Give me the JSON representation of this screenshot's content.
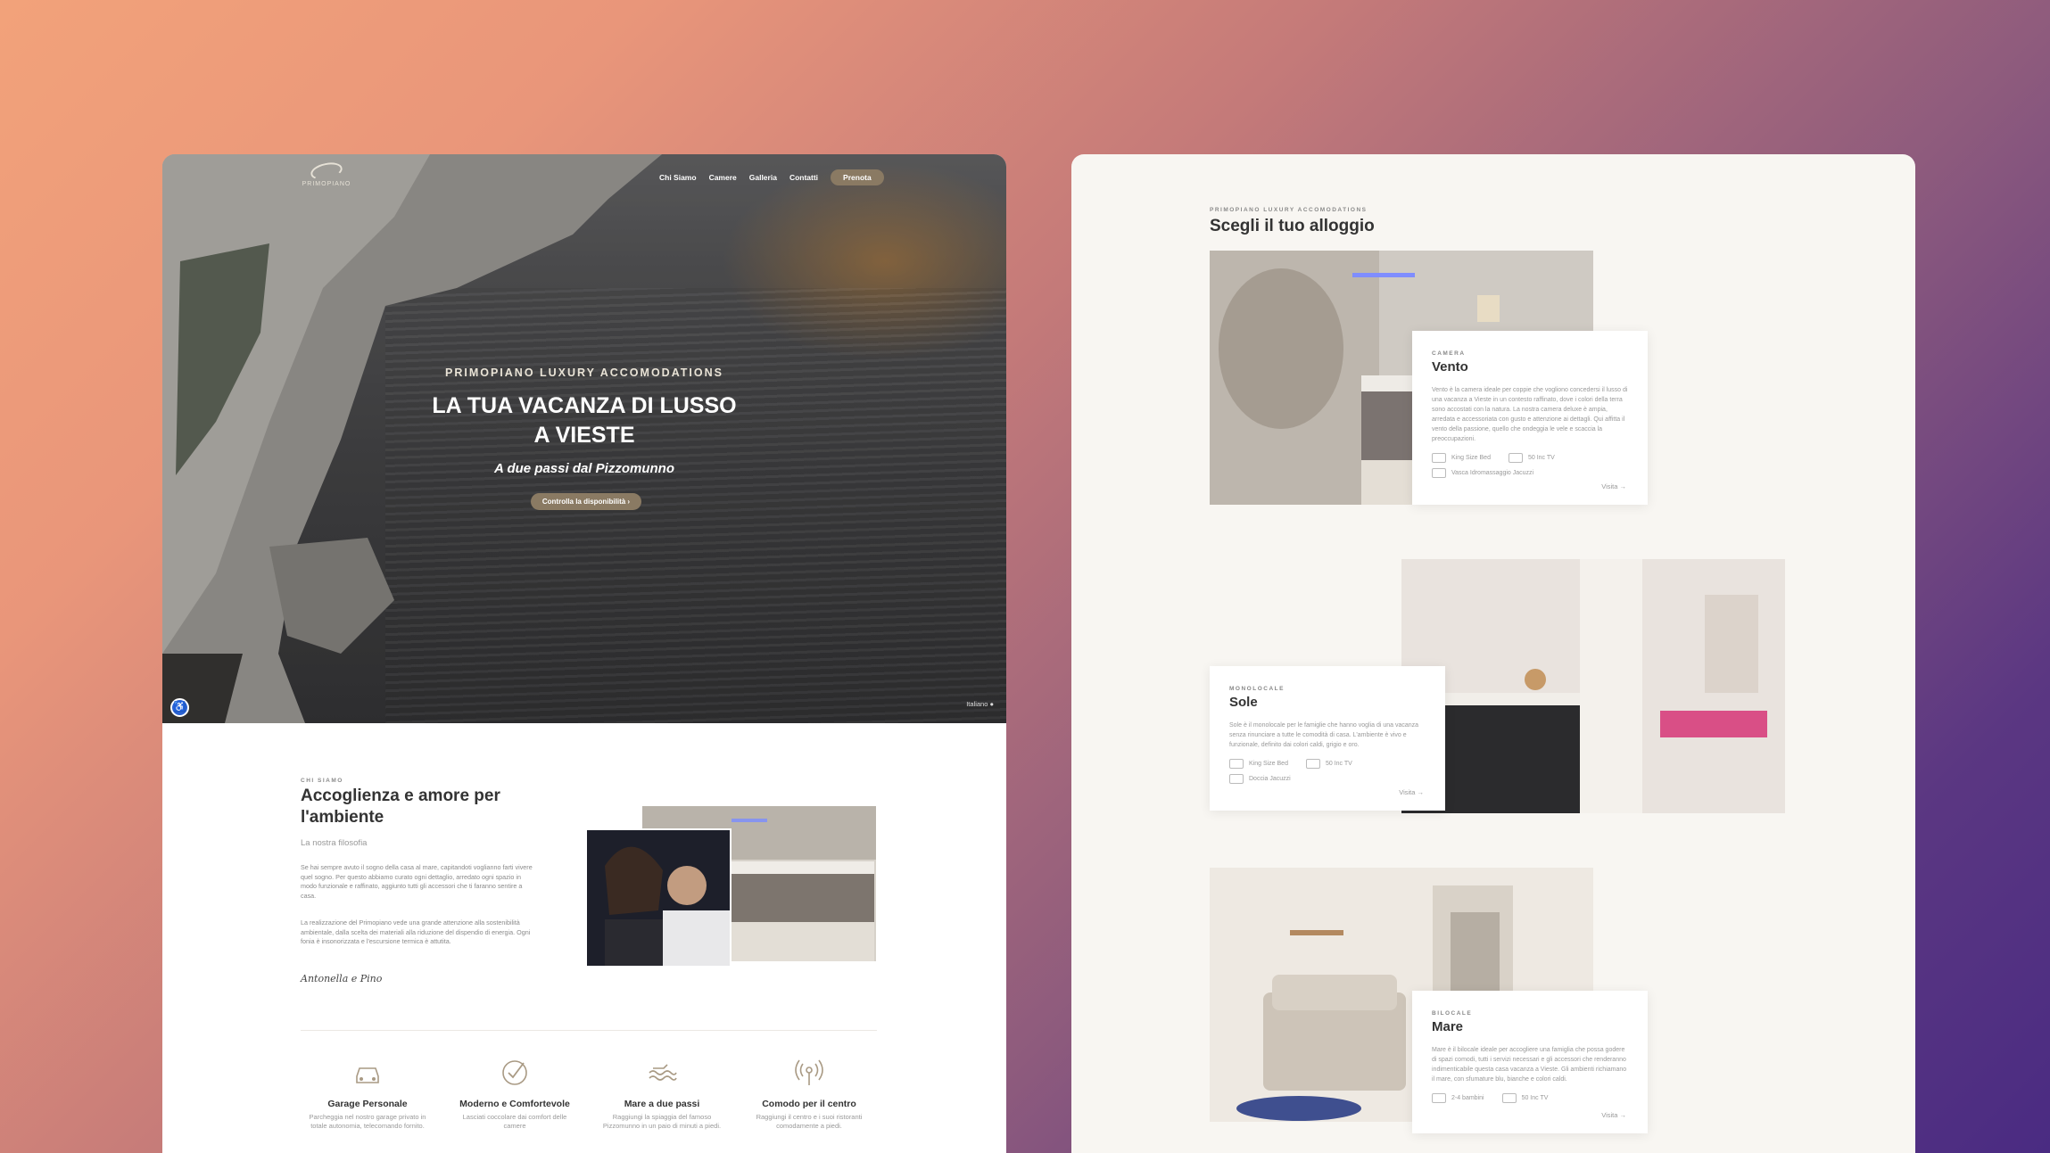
{
  "left_site": {
    "logo_text": "PRIMOPIANO",
    "nav": [
      "Chi Siamo",
      "Camere",
      "Galleria",
      "Contatti"
    ],
    "nav_button": "Prenota",
    "hero": {
      "kicker": "PRIMOPIANO LUXURY ACCOMODATIONS",
      "title_line1": "LA TUA VACANZA DI LUSSO",
      "title_line2": "A VIESTE",
      "subtitle": "A due passi dal Pizzomunno",
      "cta": "Controlla la disponibilità ›",
      "language": "Italiano"
    },
    "about": {
      "kicker": "CHI SIAMO",
      "title": "Accoglienza e amore per l'ambiente",
      "subtitle": "La nostra filosofia",
      "paragraph1": "Se hai sempre avuto il sogno della casa al mare, capitandoti voglianno farti vivere quel sogno. Per questo abbiamo curato ogni dettaglio, arredato ogni spazio in modo funzionale e raffinato, aggiunto tutti gli accessori che ti faranno sentire a casa.",
      "paragraph2": "La realizzazione del Primopiano vede una grande attenzione alla sostenibilità ambientale, dalla scelta dei materiali alla riduzione del dispendio di energia. Ogni fonia è insonorizzata e l'escursione termica è attutita.",
      "signature": "Antonella e Pino"
    },
    "features": [
      {
        "icon": "car-icon",
        "title": "Garage Personale",
        "desc": "Parcheggia nel nostro garage privato in totale autonomia, telecomando fornito."
      },
      {
        "icon": "check-circle-icon",
        "title": "Moderno e Comfortevole",
        "desc": "Lasciati coccolare dai comfort delle camere"
      },
      {
        "icon": "waves-icon",
        "title": "Mare a due passi",
        "desc": "Raggiungi la spiaggia del famoso Pizzomunno in un paio di minuti a piedi."
      },
      {
        "icon": "antenna-icon",
        "title": "Comodo per il centro",
        "desc": "Raggiungi il centro e i suoi ristoranti comodamente a piedi."
      }
    ]
  },
  "right_site": {
    "kicker": "PRIMOPIANO LUXURY ACCOMODATIONS",
    "title": "Scegli il tuo alloggio",
    "rooms": [
      {
        "kicker": "CAMERA",
        "name": "Vento",
        "desc": "Vento è la camera ideale per coppie che vogliono concedersi il lusso di una vacanza a Vieste in un contesto raffinato, dove i colori della terra sono accostati con la natura. La nostra camera deluxe è ampia, arredata e accessoriata con gusto e attenzione ai dettagli. Qui affitta il vento della passione, quello che ondeggia le vele e scaccia la preoccupazioni.",
        "amenities": [
          "King Size Bed",
          "50 Inc TV",
          "Vasca Idromassaggio Jacuzzi"
        ],
        "link": "Visita →"
      },
      {
        "kicker": "MONOLOCALE",
        "name": "Sole",
        "desc": "Sole è il monolocale per le famiglie che hanno voglia di una vacanza senza rinunciare a tutte le comodità di casa. L'ambiente è vivo e funzionale, definito dai colori caldi, grigio e oro.",
        "amenities": [
          "King Size Bed",
          "50 Inc TV",
          "Doccia Jacuzzi"
        ],
        "link": "Visita →"
      },
      {
        "kicker": "BILOCALE",
        "name": "Mare",
        "desc": "Mare è il bilocale ideale per accogliere una famiglia che possa godere di spazi comodi, tutti i servizi necessari e gli accessori che renderanno indimenticabile questa casa vacanza a Vieste. Gli ambienti richiamano il mare, con sfumature blu, bianche e colori caldi.",
        "amenities": [
          "2-4 bambini",
          "50 Inc TV"
        ],
        "link": "Visita →"
      }
    ]
  },
  "colors": {
    "accent": "#8a7a63",
    "accessibility": "#2b63d4"
  }
}
